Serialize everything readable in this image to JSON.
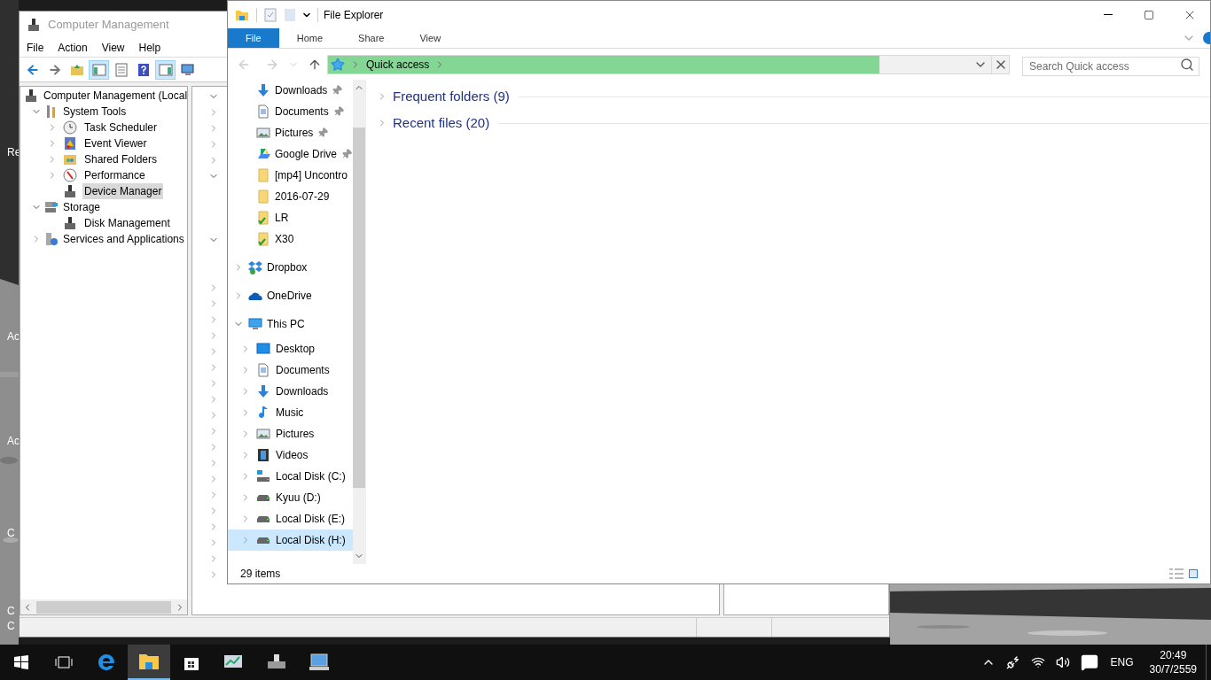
{
  "desktop": {
    "icons": [
      {
        "label": "Re"
      },
      {
        "label": "Ac"
      },
      {
        "label": "Ac"
      },
      {
        "label": "C"
      },
      {
        "label": "C"
      },
      {
        "label": "C"
      }
    ]
  },
  "computer_management": {
    "title": "Computer Management",
    "menu": [
      "File",
      "Action",
      "View",
      "Help"
    ],
    "toolbar": [
      {
        "kind": "back",
        "pressed": false
      },
      {
        "kind": "forward",
        "pressed": false
      },
      {
        "kind": "up",
        "pressed": false
      },
      {
        "kind": "tree",
        "pressed": true
      },
      {
        "kind": "properties",
        "pressed": false
      },
      {
        "kind": "help",
        "pressed": false
      },
      {
        "kind": "action-pane",
        "pressed": true
      },
      {
        "kind": "connect",
        "pressed": false
      }
    ],
    "tree": {
      "label": "Computer Management (Local",
      "children": [
        {
          "label": "System Tools",
          "kind": "tools",
          "expanded": true,
          "selected": false,
          "children": [
            {
              "label": "Task Scheduler",
              "kind": "clock",
              "expanded": false,
              "selected": false
            },
            {
              "label": "Event Viewer",
              "kind": "event",
              "expanded": false,
              "selected": false
            },
            {
              "label": "Shared Folders",
              "kind": "shared",
              "expanded": false,
              "selected": false
            },
            {
              "label": "Performance",
              "kind": "perf",
              "expanded": false,
              "selected": false
            },
            {
              "label": "Device Manager",
              "kind": "device",
              "selected": true
            }
          ]
        },
        {
          "label": "Storage",
          "kind": "storage",
          "expanded": true,
          "selected": false,
          "children": [
            {
              "label": "Disk Management",
              "kind": "disk",
              "selected": false
            }
          ]
        },
        {
          "label": "Services and Applications",
          "kind": "services",
          "expanded": false,
          "selected": false
        }
      ]
    },
    "device_rows": [
      {
        "kind": "node",
        "expanded": true
      },
      {
        "kind": "node",
        "expanded": false
      },
      {
        "kind": "node",
        "expanded": false
      },
      {
        "kind": "node",
        "expanded": false
      },
      {
        "kind": "node",
        "expanded": false
      },
      {
        "kind": "node",
        "expanded": true
      },
      {
        "kind": "leaf"
      },
      {
        "kind": "leaf"
      },
      {
        "kind": "leaf"
      },
      {
        "kind": "node",
        "expanded": true
      },
      {
        "kind": "leaf"
      },
      {
        "kind": "leaf"
      },
      {
        "kind": "node",
        "expanded": false
      },
      {
        "kind": "node",
        "expanded": false
      },
      {
        "kind": "node",
        "expanded": false
      },
      {
        "kind": "node",
        "expanded": false
      },
      {
        "kind": "node",
        "expanded": false
      },
      {
        "kind": "node",
        "expanded": false
      },
      {
        "kind": "node",
        "expanded": false
      },
      {
        "kind": "node",
        "expanded": false
      },
      {
        "kind": "node",
        "expanded": false
      },
      {
        "kind": "node",
        "expanded": false
      },
      {
        "kind": "node",
        "expanded": false
      },
      {
        "kind": "node",
        "expanded": false
      },
      {
        "kind": "node",
        "expanded": false
      },
      {
        "kind": "node",
        "expanded": false
      },
      {
        "kind": "node",
        "expanded": false
      },
      {
        "kind": "node",
        "expanded": false
      },
      {
        "kind": "node",
        "expanded": false
      },
      {
        "kind": "node",
        "expanded": false
      },
      {
        "kind": "node",
        "expanded": false
      }
    ]
  },
  "file_explorer": {
    "title": "File Explorer",
    "ribbon_tabs": [
      {
        "label": "File",
        "selected": true
      },
      {
        "label": "Home",
        "selected": false
      },
      {
        "label": "Share",
        "selected": false
      },
      {
        "label": "View",
        "selected": false
      }
    ],
    "address": {
      "location": "Quick access",
      "level": 0.81
    },
    "search": {
      "placeholder": "Search Quick access"
    },
    "nav": {
      "quick_access": [
        {
          "label": "Downloads",
          "kind": "downloads",
          "pinned": true
        },
        {
          "label": "Documents",
          "kind": "documents",
          "pinned": true
        },
        {
          "label": "Pictures",
          "kind": "pictures",
          "pinned": true
        },
        {
          "label": "Google Drive",
          "kind": "gdrive",
          "pinned": true
        },
        {
          "label": "[mp4] Uncontro",
          "kind": "folder",
          "pinned": false
        },
        {
          "label": "2016-07-29",
          "kind": "folder",
          "pinned": false
        },
        {
          "label": "LR",
          "kind": "synced",
          "pinned": false
        },
        {
          "label": "X30",
          "kind": "synced",
          "pinned": false
        }
      ],
      "roots": [
        {
          "label": "Dropbox",
          "kind": "dropbox",
          "expanded": false
        },
        {
          "label": "OneDrive",
          "kind": "onedrive",
          "expanded": false
        },
        {
          "label": "This PC",
          "kind": "pc",
          "expanded": true,
          "children": [
            {
              "label": "Desktop",
              "kind": "desktop",
              "selected": false
            },
            {
              "label": "Documents",
              "kind": "documents",
              "selected": false
            },
            {
              "label": "Downloads",
              "kind": "downloads",
              "selected": false
            },
            {
              "label": "Music",
              "kind": "music",
              "selected": false
            },
            {
              "label": "Pictures",
              "kind": "pictures",
              "selected": false
            },
            {
              "label": "Videos",
              "kind": "videos",
              "selected": false
            },
            {
              "label": "Local Disk (C:)",
              "kind": "sysdisk",
              "selected": false
            },
            {
              "label": "Kyuu (D:)",
              "kind": "disk",
              "selected": false
            },
            {
              "label": "Local Disk (E:)",
              "kind": "disk",
              "selected": false
            },
            {
              "label": "Local Disk (H:)",
              "kind": "disk",
              "selected": true
            }
          ]
        }
      ]
    },
    "groups": [
      {
        "label": "Frequent folders (9)",
        "expanded": false
      },
      {
        "label": "Recent files (20)",
        "expanded": false
      }
    ],
    "status": "29 items"
  },
  "taskbar": {
    "apps": [
      {
        "kind": "task-view",
        "selected": false
      },
      {
        "kind": "edge",
        "selected": false
      },
      {
        "kind": "explorer",
        "selected": true
      },
      {
        "kind": "store",
        "selected": false
      },
      {
        "kind": "chart",
        "selected": false
      },
      {
        "kind": "drive",
        "selected": false
      },
      {
        "kind": "computer",
        "selected": false
      }
    ],
    "tray": {
      "language": "ENG",
      "time": "20:49",
      "date": "30/7/2559"
    }
  }
}
